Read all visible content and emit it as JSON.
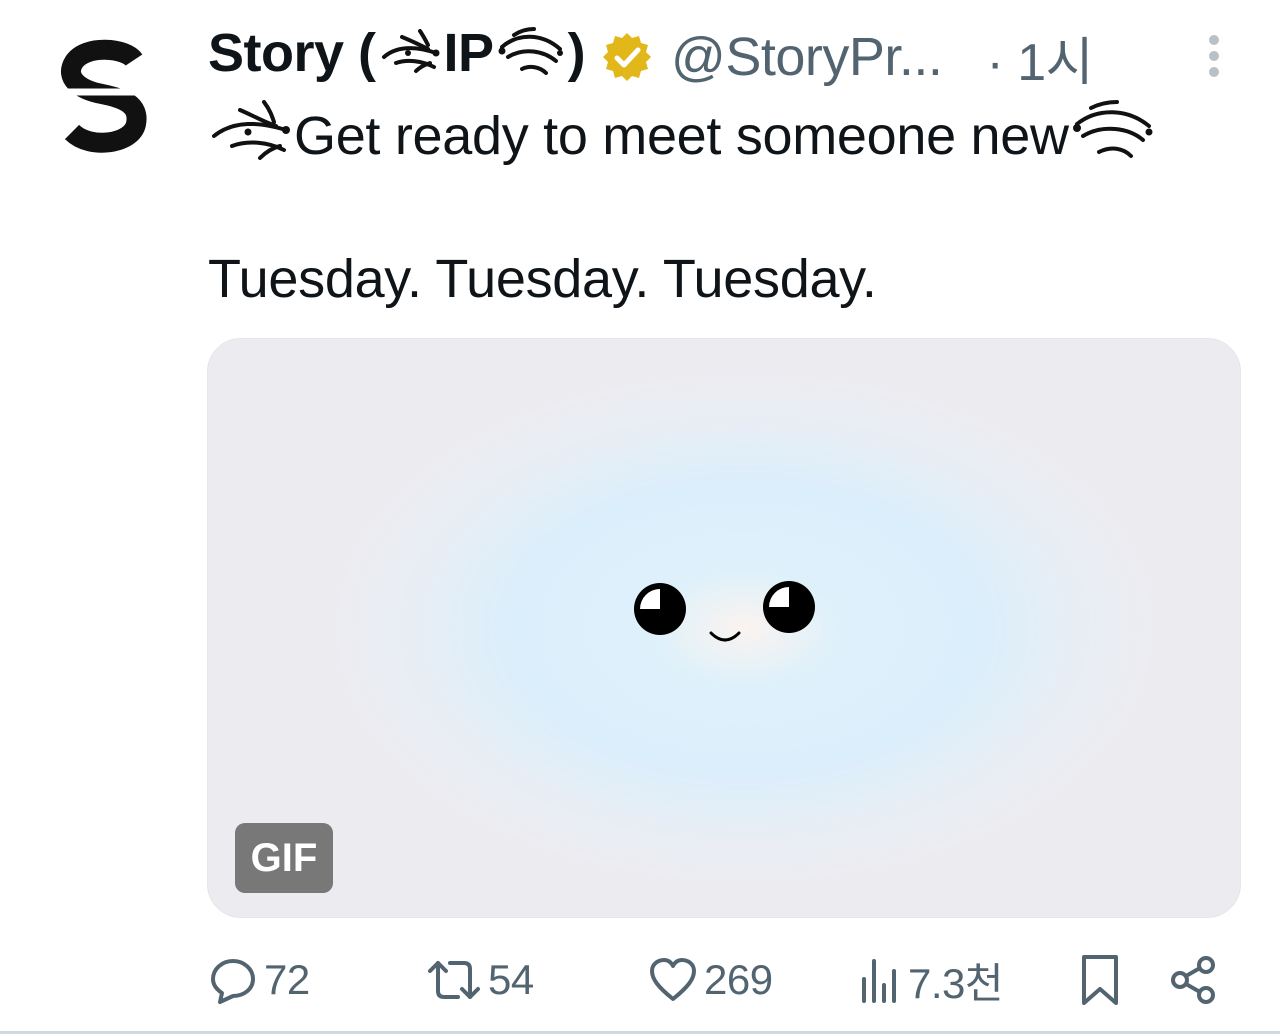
{
  "tweet": {
    "display_name_prefix": "Story (",
    "display_name_middle": "IP",
    "display_name_suffix": ")",
    "handle": "@StoryPr...",
    "time": "· 1시",
    "text_line1": "Get ready to meet someone new",
    "text_line2": "Tuesday. Tuesday. Tuesday.",
    "media": {
      "badge": "GIF"
    },
    "stats": {
      "replies": "72",
      "reposts": "54",
      "likes": "269",
      "views": "7.3천"
    }
  },
  "colors": {
    "text": "#0f1419",
    "secondary": "#536471",
    "verified_gold": "#e2b719",
    "media_bg": "#dbeefb"
  },
  "icons": {
    "avatar": "story-logo-icon",
    "verified": "verified-badge-icon",
    "more": "more-vertical-icon",
    "reply": "reply-icon",
    "repost": "repost-icon",
    "like": "heart-icon",
    "views": "views-icon",
    "bookmark": "bookmark-icon",
    "share": "share-icon"
  }
}
